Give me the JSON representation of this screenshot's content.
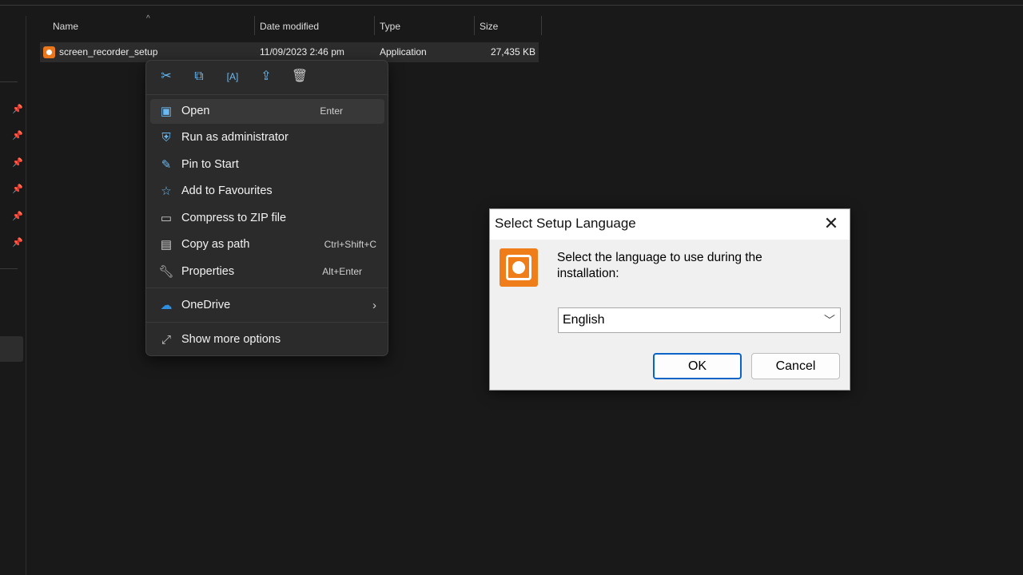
{
  "explorer": {
    "columns": {
      "name": "Name",
      "date": "Date modified",
      "type": "Type",
      "size": "Size"
    },
    "file": {
      "name": "screen_recorder_setup",
      "date": "11/09/2023 2:46 pm",
      "type": "Application",
      "size": "27,435 KB"
    }
  },
  "context_menu": {
    "toolbar": [
      "cut-icon",
      "copy-icon",
      "rename-icon",
      "share-icon",
      "delete-icon"
    ],
    "items": [
      {
        "label": "Open",
        "shortcut": "Enter",
        "icon": "open-icon"
      },
      {
        "label": "Run as administrator",
        "shortcut": "",
        "icon": "shield-icon"
      },
      {
        "label": "Pin to Start",
        "shortcut": "",
        "icon": "pin-icon"
      },
      {
        "label": "Add to Favourites",
        "shortcut": "",
        "icon": "star-icon"
      },
      {
        "label": "Compress to ZIP file",
        "shortcut": "",
        "icon": "zip-icon"
      },
      {
        "label": "Copy as path",
        "shortcut": "Ctrl+Shift+C",
        "icon": "path-icon"
      },
      {
        "label": "Properties",
        "shortcut": "Alt+Enter",
        "icon": "wrench-icon"
      },
      {
        "label": "OneDrive",
        "shortcut": "",
        "icon": "cloud-icon"
      },
      {
        "label": "Show more options",
        "shortcut": "",
        "icon": "more-icon"
      }
    ]
  },
  "dialog": {
    "title": "Select Setup Language",
    "prompt": "Select the language to use during the installation:",
    "language": "English",
    "ok": "OK",
    "cancel": "Cancel",
    "accent": "#ef7d1a"
  }
}
